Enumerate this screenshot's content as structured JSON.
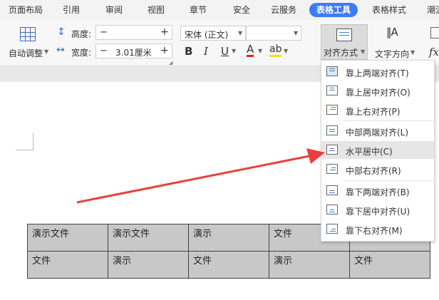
{
  "tabs": [
    "页面布局",
    "引用",
    "审阅",
    "视图",
    "章节",
    "安全",
    "云服务",
    "表格工具",
    "表格样式",
    "潮流"
  ],
  "active_tab": "表格工具",
  "ribbon": {
    "auto_adjust": "自动调整",
    "height_label": "高度:",
    "height_value": "",
    "width_label": "宽度:",
    "width_value": "3.01厘米",
    "minus": "−",
    "plus": "+",
    "font_name": "宋体 (正文)",
    "font_size": "",
    "bold": "B",
    "italic": "I",
    "underline": "U",
    "font_color": "A",
    "highlight": "ab",
    "align_label": "对齐方式",
    "text_direction_label": "文字方向",
    "fx": "fx"
  },
  "menu_items": [
    {
      "label": "靠上两端对齐(T)",
      "icon": "align-top-justify-icon"
    },
    {
      "label": "靠上居中对齐(O)",
      "icon": "align-top-center-icon"
    },
    {
      "label": "靠上右对齐(P)",
      "icon": "align-top-right-icon"
    },
    {
      "label": "中部两端对齐(L)",
      "icon": "align-middle-justify-icon"
    },
    {
      "label": "水平居中(C)",
      "icon": "align-middle-center-icon"
    },
    {
      "label": "中部右对齐(R)",
      "icon": "align-middle-right-icon"
    },
    {
      "label": "靠下两端对齐(B)",
      "icon": "align-bottom-justify-icon"
    },
    {
      "label": "靠下居中对齐(U)",
      "icon": "align-bottom-center-icon"
    },
    {
      "label": "靠下右对齐(M)",
      "icon": "align-bottom-right-icon"
    }
  ],
  "highlighted_item": "水平居中(C)",
  "table": {
    "rows": [
      [
        "演示文件",
        "演示文件",
        "演示",
        "文件",
        ""
      ],
      [
        "文件",
        "演示",
        "文件",
        "演示",
        "文件"
      ]
    ]
  },
  "colors": {
    "accent": "#3d7cf5",
    "arrow": "#e8413b",
    "cell_bg": "#c8c8c8"
  }
}
